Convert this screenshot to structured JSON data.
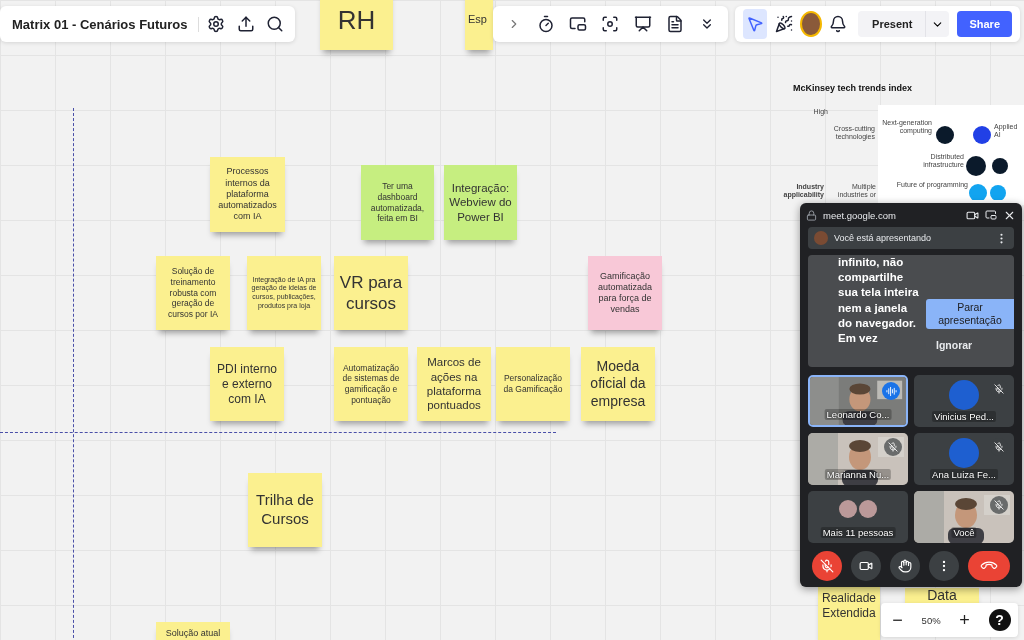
{
  "board": {
    "title": "Matrix 01 - Cenários Futuros"
  },
  "toolbar": {
    "select_active": true,
    "present": "Present",
    "share": "Share"
  },
  "notes": [
    {
      "text": "RH",
      "color": "#fbf08f"
    },
    {
      "text": "Esp",
      "color": "#fbf08f"
    },
    {
      "text": "Processos internos da plataforma automatizados com IA",
      "color": "#fbf08f"
    },
    {
      "text": "Ter uma dashboard automatizada, feita em BI",
      "color": "#c6ee80"
    },
    {
      "text": "Integração: Webview do Power BI",
      "color": "#c6ee80"
    },
    {
      "text": "Solução de treinamento robusta com geração de cursos por IA",
      "color": "#fbf08f"
    },
    {
      "text": "Integração de IA pra geração de ideias de cursos, publicações, produtos pra loja",
      "color": "#fbf08f"
    },
    {
      "text": "VR para cursos",
      "color": "#fbf08f"
    },
    {
      "text": "Gamificação automatizada para força de vendas",
      "color": "#f8c8d7"
    },
    {
      "text": "PDI interno e externo com IA",
      "color": "#fbf08f"
    },
    {
      "text": "Automatização de sistemas de gamificação e pontuação",
      "color": "#fbf08f"
    },
    {
      "text": "Marcos de ações na plataforma pontuados",
      "color": "#fbf08f"
    },
    {
      "text": "Personalização da Gamificação",
      "color": "#fbf08f"
    },
    {
      "text": "Moeda oficial da empresa",
      "color": "#fbf08f"
    },
    {
      "text": "Trilha de Cursos",
      "color": "#fbf08f"
    },
    {
      "text": "Solução atual",
      "color": "#fbf08f"
    },
    {
      "text": "Realidade Extendida",
      "color": "#fbf08f"
    },
    {
      "text": "Data",
      "color": "#fbf08f"
    }
  ],
  "chart_card": {
    "title": "McKinsey tech trends index",
    "labels": [
      "High",
      "Cross-cutting technologies",
      "Industry applicability",
      "Multiple industries or",
      "Next-generation computing",
      "Applied AI",
      "Distributed infrastructure",
      "Future of programming"
    ]
  },
  "meet": {
    "url": "meet.google.com",
    "banner": "Você está apresentando",
    "preview_text": "infinito, não compartilhe sua tela inteira nem a janela do navegador. Em vez",
    "stop_button": "Parar apresentação",
    "ignore_button": "Ignorar",
    "mic_muted": true,
    "tiles": [
      {
        "kind": "video",
        "name": "Leonardo Co...",
        "speaking": true,
        "muted": false
      },
      {
        "kind": "avatar",
        "name": "Vinicius Ped...",
        "speaking": false,
        "muted": true
      },
      {
        "kind": "video",
        "name": "Marianna Nu...",
        "speaking": false,
        "muted": true
      },
      {
        "kind": "avatar",
        "name": "Ana Luiza Fe...",
        "speaking": false,
        "muted": true
      },
      {
        "kind": "more",
        "name": "Mais 11 pessoas",
        "speaking": false,
        "muted": false
      },
      {
        "kind": "video",
        "name": "Você",
        "speaking": false,
        "muted": true
      }
    ]
  },
  "zoom": {
    "minus": "−",
    "level": "50%",
    "plus": "+",
    "help": "?"
  }
}
